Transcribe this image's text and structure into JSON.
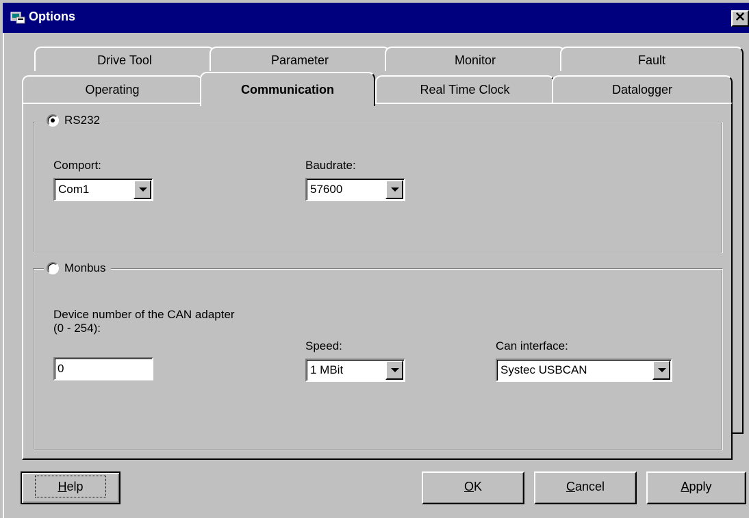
{
  "window": {
    "title": "Options",
    "close_glyph": "✕"
  },
  "tabs_back_row": [
    "Drive Tool",
    "Parameter",
    "Monitor",
    "Fault"
  ],
  "tabs_front_row": [
    "Operating",
    "Communication",
    "Real Time Clock",
    "Datalogger"
  ],
  "selected_tab": "Communication",
  "rs232": {
    "legend": "RS232",
    "selected": true,
    "comport_label": "Comport:",
    "comport_value": "Com1",
    "baudrate_label": "Baudrate:",
    "baudrate_value": "57600"
  },
  "monbus": {
    "legend": "Monbus",
    "selected": false,
    "device_label_line1": "Device number of the CAN adapter",
    "device_label_line2": "(0 - 254):",
    "device_value": "0",
    "speed_label": "Speed:",
    "speed_value": "1 MBit",
    "can_label": "Can interface:",
    "can_value": "Systec USBCAN"
  },
  "buttons": {
    "help_first": "H",
    "help_rest": "elp",
    "ok_first": "O",
    "ok_rest": "K",
    "cancel_first": "C",
    "cancel_rest": "ancel",
    "apply_first": "A",
    "apply_rest": "pply"
  }
}
